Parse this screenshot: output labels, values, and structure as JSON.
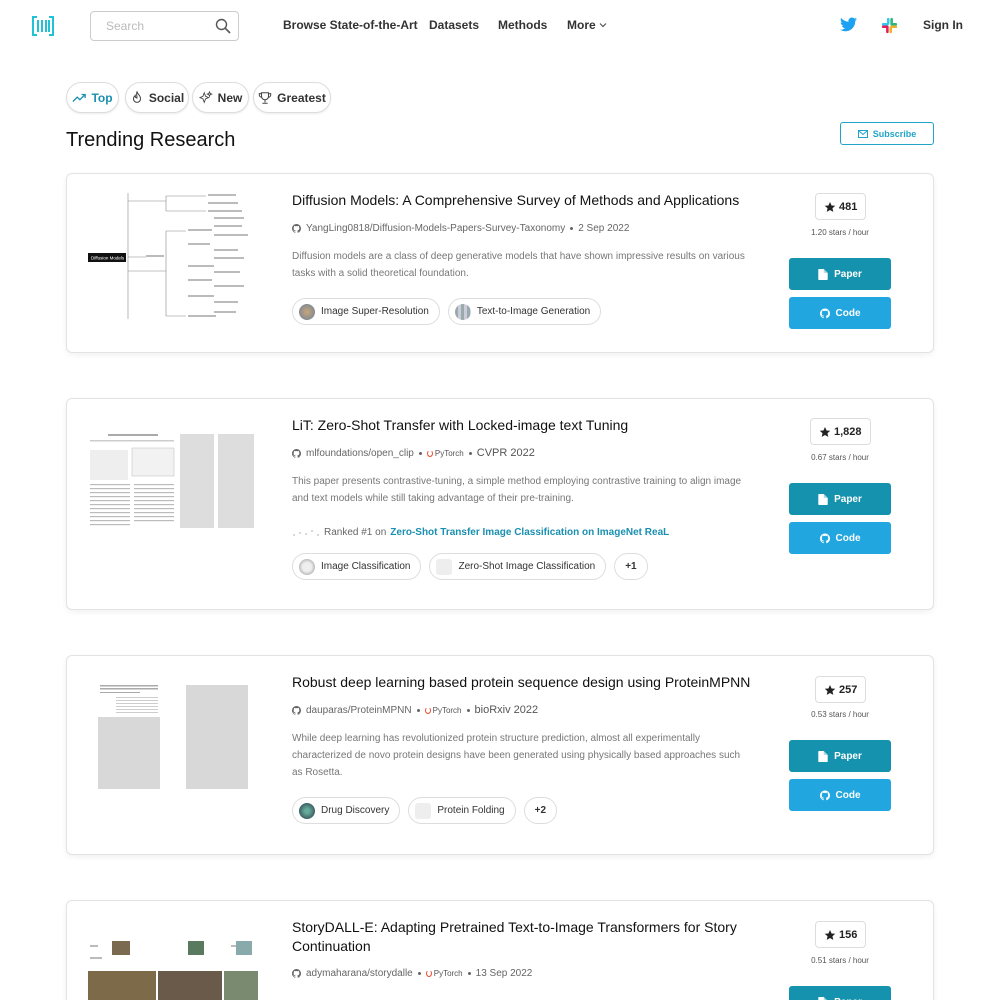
{
  "header": {
    "search_placeholder": "Search",
    "nav": [
      "Browse State-of-the-Art",
      "Datasets",
      "Methods",
      "More"
    ],
    "sign_in": "Sign In"
  },
  "filters": [
    "Top",
    "Social",
    "New",
    "Greatest"
  ],
  "page_title": "Trending Research",
  "subscribe_label": "Subscribe",
  "papers": [
    {
      "title": "Diffusion Models: A Comprehensive Survey of Methods and Applications",
      "repo": "YangLing0818/Diffusion-Models-Papers-Survey-Taxonomy",
      "date": "2 Sep 2022",
      "abstract": "Diffusion models are a class of deep generative models that have shown impressive results on various tasks with a solid theoretical foundation.",
      "tags": [
        "Image Super-Resolution",
        "Text-to-Image Generation"
      ],
      "stars": "481",
      "rate": "1.20 stars / hour",
      "thumb_label": "Diffusion Models"
    },
    {
      "title": "LiT: Zero-Shot Transfer with Locked-image text Tuning",
      "repo": "mlfoundations/open_clip",
      "framework": "PyTorch",
      "venue": "CVPR 2022",
      "abstract": "This paper presents contrastive-tuning, a simple method employing contrastive training to align image and text models while still taking advantage of their pre-training.",
      "ranked_prefix": "Ranked #1 on",
      "ranked_link": "Zero-Shot Transfer Image Classification on ImageNet ReaL",
      "tags": [
        "Image Classification",
        "Zero-Shot Image Classification"
      ],
      "more": "+1",
      "stars": "1,828",
      "rate": "0.67 stars / hour"
    },
    {
      "title": "Robust deep learning based protein sequence design using ProteinMPNN",
      "repo": "dauparas/ProteinMPNN",
      "framework": "PyTorch",
      "venue": "bioRxiv 2022",
      "abstract": "While deep learning has revolutionized protein structure prediction, almost all experimentally characterized de novo protein designs have been generated using physically based approaches such as Rosetta.",
      "tags": [
        "Drug Discovery",
        "Protein Folding"
      ],
      "more": "+2",
      "stars": "257",
      "rate": "0.53 stars / hour"
    },
    {
      "title": "StoryDALL-E: Adapting Pretrained Text-to-Image Transformers for Story Continuation",
      "repo": "adymaharana/storydalle",
      "framework": "PyTorch",
      "date": "13 Sep 2022",
      "stars": "156",
      "rate": "0.51 stars / hour"
    }
  ],
  "buttons": {
    "paper": "Paper",
    "code": "Code"
  },
  "colors": {
    "accent": "#21a4c7",
    "paper_button": "#1592ad",
    "code_button": "#21a6e0",
    "twitter": "#1da1f2"
  },
  "icons": [
    "pwc-logo-icon",
    "search-icon",
    "chevron-down-icon",
    "twitter-icon",
    "slack-icon",
    "trend-icon",
    "flame-icon",
    "sparkle-icon",
    "trophy-icon",
    "mail-icon",
    "github-icon",
    "star-icon",
    "file-icon"
  ]
}
